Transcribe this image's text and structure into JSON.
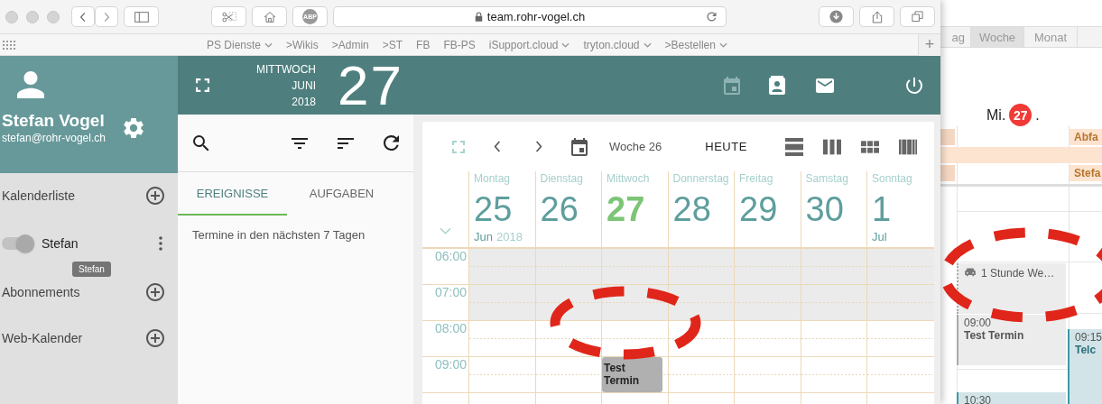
{
  "browser": {
    "adblock_badge": "ABP",
    "url": "team.rohr-vogel.ch",
    "new_tab": "+",
    "bookmarks": [
      {
        "label": "PS Dienste",
        "dropdown": true
      },
      {
        "label": ">Wikis",
        "dropdown": false
      },
      {
        "label": ">Admin",
        "dropdown": false
      },
      {
        "label": ">ST",
        "dropdown": false
      },
      {
        "label": "FB",
        "dropdown": false
      },
      {
        "label": "FB-PS",
        "dropdown": false
      },
      {
        "label": "iSupport.cloud",
        "dropdown": true
      },
      {
        "label": "tryton.cloud",
        "dropdown": true
      },
      {
        "label": ">Bestellen",
        "dropdown": true
      }
    ]
  },
  "user": {
    "name": "Stefan Vogel",
    "email": "stefan@rohr-vogel.ch"
  },
  "sidebar": {
    "tooltip": "Stefan",
    "items": [
      {
        "kind": "section",
        "label": "Kalenderliste"
      },
      {
        "kind": "calendar",
        "label": "Stefan",
        "on": true
      },
      {
        "kind": "section",
        "label": "Abonnements"
      },
      {
        "kind": "section",
        "label": "Web-Kalender"
      }
    ]
  },
  "date_header": {
    "weekday": "MITTWOCH",
    "month": "JUNI",
    "year": "2018",
    "day": "27"
  },
  "list_panel": {
    "message": "Termine in den nächsten 7 Tagen",
    "tabs": [
      {
        "label": "EREIGNISSE",
        "selected": true
      },
      {
        "label": "AUFGABEN",
        "selected": false
      }
    ]
  },
  "calendar": {
    "week_label": "Woche 26",
    "today_button": "HEUTE",
    "views": [
      {
        "kind": "day"
      },
      {
        "kind": "week"
      },
      {
        "kind": "month"
      },
      {
        "kind": "list"
      }
    ],
    "days": [
      {
        "weekday": "Montag",
        "day": "25",
        "today": false,
        "month": "Jun",
        "year": "2018"
      },
      {
        "weekday": "Dienstag",
        "day": "26",
        "today": false
      },
      {
        "weekday": "Mittwoch",
        "day": "27",
        "today": true
      },
      {
        "weekday": "Donnerstag",
        "day": "28",
        "today": false
      },
      {
        "weekday": "Freitag",
        "day": "29",
        "today": false
      },
      {
        "weekday": "Samstag",
        "day": "30",
        "today": false
      },
      {
        "weekday": "Sonntag",
        "day": "1",
        "today": false,
        "month": "Jul"
      }
    ],
    "rows": [
      {
        "time": "06:00",
        "shaded": true
      },
      {
        "time": "07:00",
        "shaded": true
      },
      {
        "time": "08:00",
        "shaded": false
      },
      {
        "time": "09:00",
        "shaded": false,
        "cells": [
          {
            "busy": false
          },
          {
            "busy": false
          },
          {
            "busy": true,
            "title": "Test Termin"
          },
          {
            "busy": false
          },
          {
            "busy": false
          },
          {
            "busy": false
          },
          {
            "busy": false
          }
        ]
      }
    ]
  },
  "annotations": [
    {
      "kind": "dashed-ellipse"
    },
    {
      "kind": "dashed-ellipse"
    }
  ],
  "background_calendar": {
    "day_name": "Mi.",
    "day_number": "27",
    "day_suffix": ".",
    "view_tabs": [
      {
        "label": "ag",
        "selected": false
      },
      {
        "label": "Woche",
        "selected": true
      },
      {
        "label": "Monat",
        "selected": false
      }
    ],
    "all_day": [
      {
        "title": "Abfa"
      },
      {
        "title": "Stefa"
      }
    ],
    "events": [
      {
        "kind": "travel",
        "title": "1 Stunde We…"
      },
      {
        "kind": "timed",
        "time": "09:00",
        "title": "Test Termin"
      },
      {
        "kind": "timed",
        "time": "09:15",
        "title": "Telc"
      },
      {
        "kind": "timed",
        "time": "10:30"
      }
    ]
  }
}
